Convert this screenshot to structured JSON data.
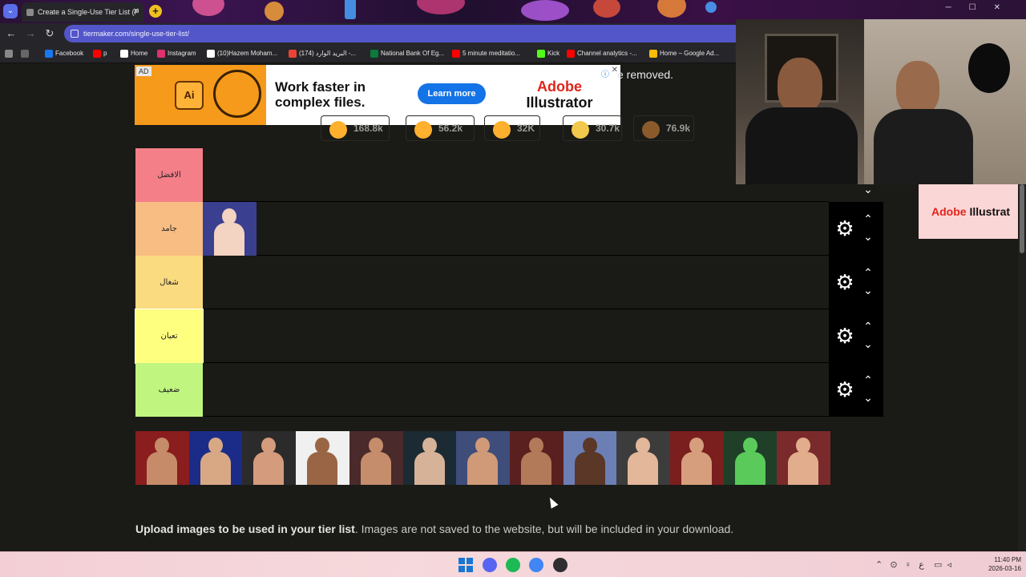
{
  "browser": {
    "active_tab_title": "Create a Single-Use Tier List (P",
    "url": "tiermaker.com/single-use-tier-list/",
    "bookmarks": [
      {
        "label": "Facebook",
        "icon": "facebook-icon",
        "color": "#1877f2"
      },
      {
        "label": "p",
        "icon": "youtube-icon",
        "color": "#ff0000"
      },
      {
        "label": "Home",
        "icon": "x-icon",
        "color": "#ffffff"
      },
      {
        "label": "Instagram",
        "icon": "instagram-icon",
        "color": "#e1306c"
      },
      {
        "label": "(10)Hazem Moham...",
        "icon": "tiktok-icon",
        "color": "#ffffff"
      },
      {
        "label": "(174) البريد الوارد -...",
        "icon": "gmail-icon",
        "color": "#ea4335"
      },
      {
        "label": "National Bank Of Eg...",
        "icon": "bank-icon",
        "color": "#0b7a3b"
      },
      {
        "label": "5 minute meditatio...",
        "icon": "youtube-icon",
        "color": "#ff0000"
      },
      {
        "label": "Kick",
        "icon": "kick-icon",
        "color": "#53fc18"
      },
      {
        "label": "Channel analytics -...",
        "icon": "youtube-icon",
        "color": "#ff0000"
      },
      {
        "label": "Home – Google Ad...",
        "icon": "google-ads-icon",
        "color": "#fbbc04"
      }
    ]
  },
  "ad": {
    "tag": "AD",
    "headline": "Work faster in complex files.",
    "cta": "Learn more",
    "brand_line1": "Adobe",
    "brand_line2": "Illustrator"
  },
  "side_ad": {
    "brand_line1": "Adobe",
    "brand_line2": "Illustrat"
  },
  "notice_tail": "e removed.",
  "reactions": [
    {
      "emoji": "laughing-emoji-icon",
      "count": "168.8k",
      "color": "#ffb02e"
    },
    {
      "emoji": "grinning-emoji-icon",
      "count": "56.2k",
      "color": "#ffb02e"
    },
    {
      "emoji": "rofl-emoji-icon",
      "count": "32K",
      "color": "#ffb02e"
    },
    {
      "emoji": "clap-emoji-icon",
      "count": "30.7k",
      "color": "#f2c94c"
    },
    {
      "emoji": "poop-emoji-icon",
      "count": "76.9k",
      "color": "#8b5a2b"
    }
  ],
  "tiers": [
    {
      "label": "الافضل",
      "color": "#f47f88",
      "items": []
    },
    {
      "label": "جامد",
      "color": "#f8bd83",
      "items": [
        {
          "name": "sheamus",
          "bg": "#3b3f8f",
          "skin": "#f3d3c1"
        }
      ]
    },
    {
      "label": "شغال",
      "color": "#fbdb7f",
      "items": []
    },
    {
      "label": "تعبان",
      "color": "#feff7f",
      "items": [],
      "selected": true
    },
    {
      "label": "ضعيف",
      "color": "#c0f580",
      "items": []
    }
  ],
  "pool": [
    {
      "name": "randy-orton",
      "bg": "#8a1d1d",
      "skin": "#c68b68"
    },
    {
      "name": "aj-styles",
      "bg": "#1b2c88",
      "skin": "#d8a885"
    },
    {
      "name": "triple-h",
      "bg": "#2b2b2b",
      "skin": "#d49b7c"
    },
    {
      "name": "the-rock",
      "bg": "#f0f0f0",
      "skin": "#9a6544"
    },
    {
      "name": "big-show",
      "bg": "#4a2a2a",
      "skin": "#c58d6c"
    },
    {
      "name": "undertaker",
      "bg": "#1c2a33",
      "skin": "#d6b298"
    },
    {
      "name": "shawn-michaels",
      "bg": "#3e4d7a",
      "skin": "#d09a78"
    },
    {
      "name": "kane",
      "bg": "#5a2020",
      "skin": "#b37a5a"
    },
    {
      "name": "mark-henry",
      "bg": "#6c7fb5",
      "skin": "#5a3726"
    },
    {
      "name": "brock-lesnar",
      "bg": "#3c3c3c",
      "skin": "#e2b79a"
    },
    {
      "name": "john-cena",
      "bg": "#7a1e1e",
      "skin": "#d79e7d"
    },
    {
      "name": "rey-mysterio",
      "bg": "#1f3f28",
      "skin": "#5acb5a"
    },
    {
      "name": "edge",
      "bg": "#7a2a2a",
      "skin": "#e2ad8c"
    }
  ],
  "upload": {
    "bold": "Upload images to be used in your tier list",
    "rest": ". Images are not saved to the website, but will be included in your download."
  },
  "taskbar": {
    "clock_time": "11:40 PM",
    "clock_date": "2026-03-16",
    "tray_lang": "ع",
    "apps": [
      {
        "name": "start-icon"
      },
      {
        "name": "discord-icon",
        "color": "#5865f2"
      },
      {
        "name": "spotify-icon",
        "color": "#1db954"
      },
      {
        "name": "chrome-icon",
        "color": "#4285f4"
      },
      {
        "name": "obs-icon",
        "color": "#302e31"
      }
    ]
  }
}
